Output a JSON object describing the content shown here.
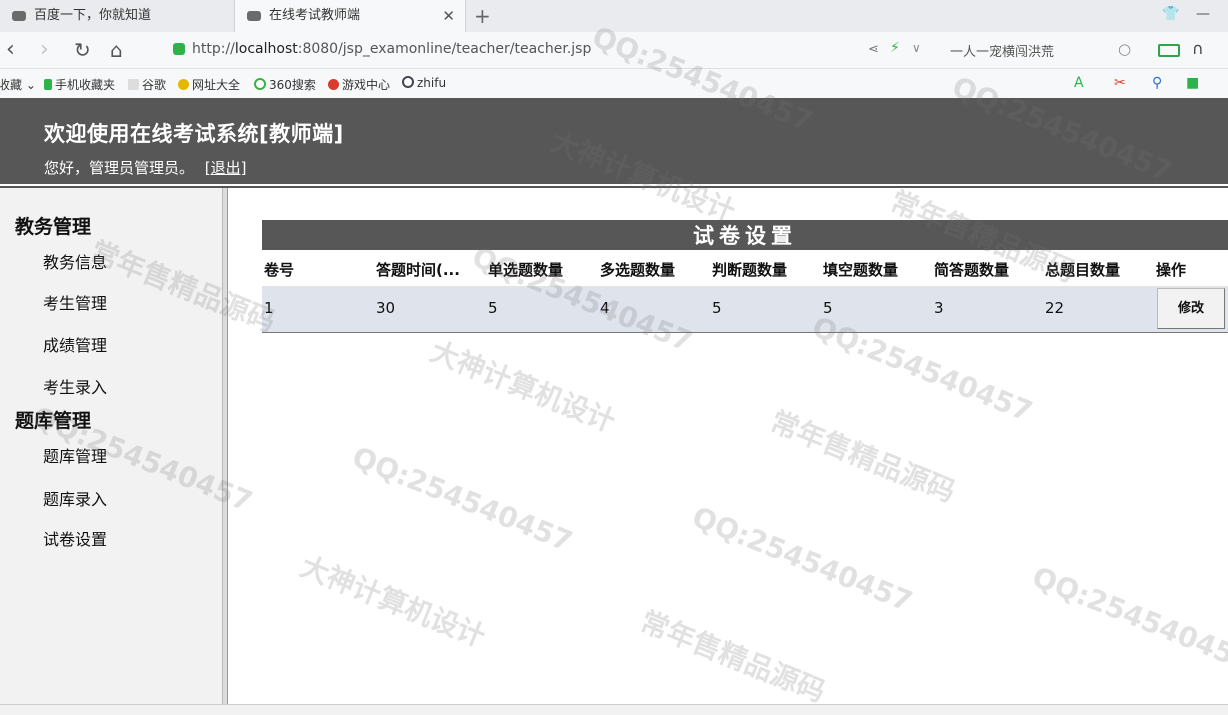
{
  "browser": {
    "tabs": [
      {
        "title": "百度一下，你就知道",
        "active": false
      },
      {
        "title": "在线考试教师端",
        "active": true
      }
    ],
    "new_tab_glyph": "+",
    "url_prefix": "http://",
    "url_host": "localhost",
    "url_rest": ":8080/jsp_examonline/teacher/teacher.jsp",
    "search_text": "一人一宠横闯洪荒",
    "bookmarks": [
      "收藏",
      "手机收藏夹",
      "谷歌",
      "网址大全",
      "360搜索",
      "游戏中心",
      "zhifu"
    ],
    "icons": [
      "back-icon",
      "forward-icon",
      "reload-icon",
      "home-icon",
      "secure-icon",
      "share-icon",
      "bolt-icon",
      "search-icon",
      "battery-icon",
      "headphones-icon"
    ]
  },
  "header": {
    "title": "欢迎使用在线考试系统[教师端]",
    "greeting": "您好，管理员管理员。",
    "logout": "[退出]"
  },
  "sidebar": {
    "sections": [
      {
        "label": "教务管理",
        "items": [
          "教务信息",
          "考生管理",
          "成绩管理",
          "考生录入"
        ]
      },
      {
        "label": "题库管理",
        "items": [
          "题库管理",
          "题库录入",
          "试卷设置"
        ]
      }
    ]
  },
  "main": {
    "title": "试卷设置",
    "columns": [
      "卷号",
      "答题时间(...",
      "单选题数量",
      "多选题数量",
      "判断题数量",
      "填空题数量",
      "简答题数量",
      "总题目数量",
      "操作"
    ],
    "row": [
      "1",
      "30",
      "5",
      "4",
      "5",
      "5",
      "3",
      "22"
    ],
    "edit_label": "修改"
  },
  "watermarks": [
    "QQ:254540457",
    "常年售精品源码",
    "大神计算机设计"
  ]
}
